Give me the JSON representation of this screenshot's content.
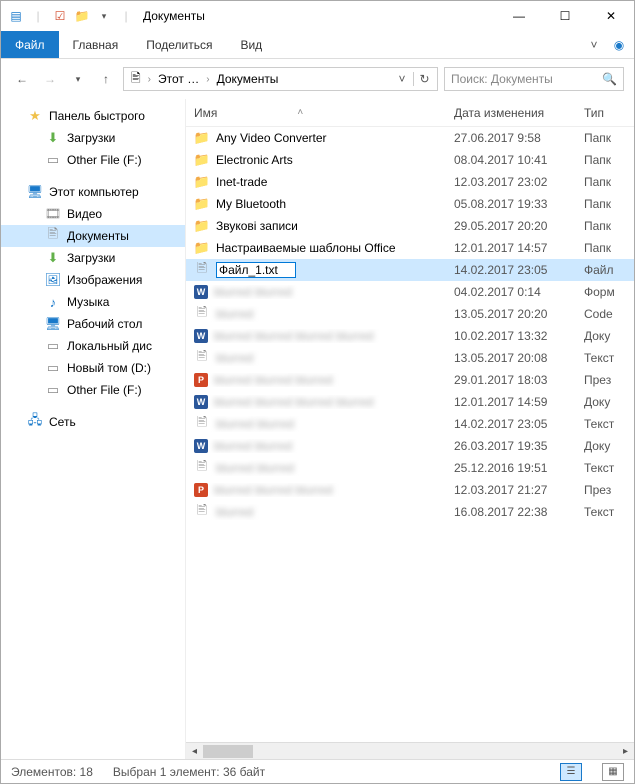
{
  "titlebar": {
    "title": "Документы"
  },
  "ribbon": {
    "file": "Файл",
    "home": "Главная",
    "share": "Поделиться",
    "view": "Вид"
  },
  "breadcrumb": {
    "part1": "Этот …",
    "part2": "Документы"
  },
  "search": {
    "placeholder": "Поиск: Документы"
  },
  "sidebar": {
    "quick_access": "Панель быстрого",
    "downloads": "Загрузки",
    "other_file": "Other File (F:)",
    "this_pc": "Этот компьютер",
    "video": "Видео",
    "documents": "Документы",
    "downloads2": "Загрузки",
    "images": "Изображения",
    "music": "Музыка",
    "desktop": "Рабочий стол",
    "local_disk": "Локальный дис",
    "new_volume": "Новый том (D:)",
    "other_file2": "Other File (F:)",
    "network": "Сеть"
  },
  "columns": {
    "name": "Имя",
    "date": "Дата изменения",
    "type": "Тип"
  },
  "files": [
    {
      "icon": "folder",
      "name": "Any Video Converter",
      "date": "27.06.2017 9:58",
      "type": "Папк"
    },
    {
      "icon": "folder",
      "name": "Electronic Arts",
      "date": "08.04.2017 10:41",
      "type": "Папк"
    },
    {
      "icon": "folder",
      "name": "Inet-trade",
      "date": "12.03.2017 23:02",
      "type": "Папк"
    },
    {
      "icon": "folder",
      "name": "My Bluetooth",
      "date": "05.08.2017 19:33",
      "type": "Папк"
    },
    {
      "icon": "folder",
      "name": "Звукові записи",
      "date": "29.05.2017 20:20",
      "type": "Папк"
    },
    {
      "icon": "folder",
      "name": "Настраиваемые шаблоны Office",
      "date": "12.01.2017 14:57",
      "type": "Папк"
    },
    {
      "icon": "text",
      "name": "Файл_1.txt",
      "date": "14.02.2017 23:05",
      "type": "Файл",
      "selected": true,
      "rename": true
    },
    {
      "icon": "word",
      "name": "blurred blurred",
      "date": "04.02.2017 0:14",
      "type": "Форм",
      "blur": true
    },
    {
      "icon": "text",
      "name": "blurred",
      "date": "13.05.2017 20:20",
      "type": "Code",
      "blur": true
    },
    {
      "icon": "word",
      "name": "blurred blurred blurred blurred",
      "date": "10.02.2017 13:32",
      "type": "Доку",
      "blur": true
    },
    {
      "icon": "text",
      "name": "blurred",
      "date": "13.05.2017 20:08",
      "type": "Текст",
      "blur": true
    },
    {
      "icon": "ppt",
      "name": "blurred blurred blurred",
      "date": "29.01.2017 18:03",
      "type": "През",
      "blur": true
    },
    {
      "icon": "word",
      "name": "blurred blurred blurred blurred",
      "date": "12.01.2017 14:59",
      "type": "Доку",
      "blur": true
    },
    {
      "icon": "text",
      "name": "blurred blurred",
      "date": "14.02.2017 23:05",
      "type": "Текст",
      "blur": true
    },
    {
      "icon": "word",
      "name": "blurred blurred",
      "date": "26.03.2017 19:35",
      "type": "Доку",
      "blur": true
    },
    {
      "icon": "text",
      "name": "blurred blurred",
      "date": "25.12.2016 19:51",
      "type": "Текст",
      "blur": true
    },
    {
      "icon": "ppt",
      "name": "blurred blurred blurred",
      "date": "12.03.2017 21:27",
      "type": "През",
      "blur": true
    },
    {
      "icon": "text",
      "name": "blurred",
      "date": "16.08.2017 22:38",
      "type": "Текст",
      "blur": true
    }
  ],
  "status": {
    "count": "Элементов: 18",
    "selection": "Выбран 1 элемент: 36 байт"
  }
}
